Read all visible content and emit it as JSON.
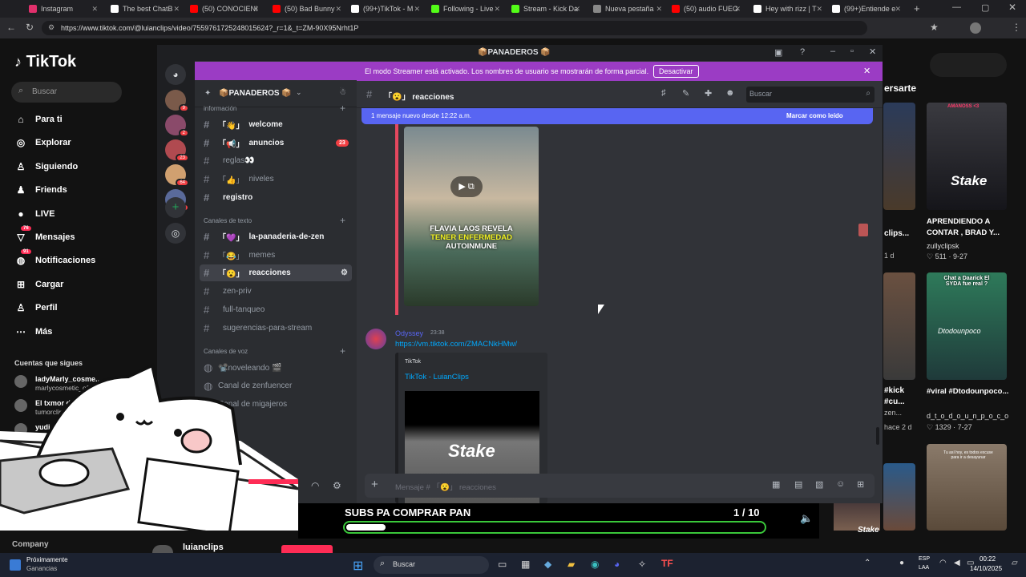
{
  "browser": {
    "tabs": [
      {
        "label": "Instagram",
        "color": "#e1306c"
      },
      {
        "label": "The best ChatB",
        "color": "#ffffff"
      },
      {
        "label": "(50) CONOCIENI",
        "color": "#ff0000"
      },
      {
        "label": "(50) Bad Bunny",
        "color": "#ff0000"
      },
      {
        "label": "(99+)TikTok - M",
        "color": "#ffffff"
      },
      {
        "label": "Following - Live",
        "color": "#53fc18"
      },
      {
        "label": "Stream - Kick Da",
        "color": "#53fc18"
      },
      {
        "label": "Nueva pestaña",
        "color": "#888888"
      },
      {
        "label": "(50) audio FUEG",
        "color": "#ff0000"
      },
      {
        "label": "Hey with rizz | T",
        "color": "#ffffff"
      },
      {
        "label": "(99+)Entiende e",
        "color": "#ffffff"
      }
    ],
    "url": "https://www.tiktok.com/@luianclips/video/7559761725248015624?_r=1&_t=ZM-90X95Nrht1P"
  },
  "tiktok": {
    "logo": "TikTok",
    "search_placeholder": "Buscar",
    "nav": [
      {
        "label": "Para ti",
        "icon": "home-icon"
      },
      {
        "label": "Explorar",
        "icon": "compass-icon"
      },
      {
        "label": "Siguiendo",
        "icon": "following-icon"
      },
      {
        "label": "Friends",
        "icon": "friends-icon"
      },
      {
        "label": "LIVE",
        "icon": "live-icon"
      },
      {
        "label": "Mensajes",
        "icon": "message-icon",
        "badge": "76"
      },
      {
        "label": "Notificaciones",
        "icon": "inbox-icon",
        "badge": "91"
      },
      {
        "label": "Cargar",
        "icon": "upload-icon"
      },
      {
        "label": "Perfil",
        "icon": "profile-icon"
      },
      {
        "label": "Más",
        "icon": "more-icon"
      }
    ],
    "following_title": "Cuentas que sigues",
    "following": [
      {
        "name": "ladyMarly_cosme...",
        "handle": "marlycosmetic_ofici"
      },
      {
        "name": "El txmor de M...",
        "handle": "tumorclips"
      },
      {
        "name": "yudi...",
        "handle": ""
      }
    ],
    "company": "Company",
    "bottom_handle": "luianclips",
    "right_heading": "ersarte",
    "right_cards": [
      {
        "title": "APRENDIENDO A CONTAR , BRAD Y...",
        "author": "zullyclipsk",
        "likes": "511",
        "date": "9-27",
        "overlay": "AMANOSS <3",
        "logo": "Stake"
      },
      {
        "title": "#viral #Dtodounpoco...",
        "author": "d_t_o_d_o_u_n_p_o_c_o",
        "likes": "1329",
        "date": "7-27",
        "overlay": "Chat a Daarick El SYDA fue real ?",
        "watermark": "Dtodounpoco"
      },
      {
        "title": "",
        "author": "",
        "likes": "",
        "date": "",
        "overlay": "Tu así hoy, es todos excuse para ir a desayunar",
        "logo": ""
      }
    ],
    "left_partial": [
      {
        "text": "clips..."
      },
      {
        "text": "1 d"
      },
      {
        "text": "#kick"
      },
      {
        "text": "#cu..."
      },
      {
        "text": "zen..."
      },
      {
        "text": "hace 2 d"
      }
    ]
  },
  "discord": {
    "window_title": "📦PANADEROS 📦",
    "banner": "El modo Streamer está activado. Los nombres de usuario se mostrarán de forma parcial.",
    "banner_button": "Desactivar",
    "server_name": "📦PANADEROS 📦",
    "server_badges": [
      "9",
      "2",
      "23",
      "64",
      "8"
    ],
    "categories": {
      "info": "información",
      "text": "Canales de texto",
      "voice": "Canales de voz"
    },
    "channels_info": [
      {
        "name": "welcome",
        "emoji": "「👋」",
        "bright": true
      },
      {
        "name": "anuncios",
        "emoji": "「📢」",
        "bright": true,
        "badge": "23"
      },
      {
        "name": "reglas👀",
        "emoji": "",
        "bright": false
      },
      {
        "name": "niveles",
        "emoji": "「👍」",
        "bright": false
      },
      {
        "name": "registro",
        "emoji": "",
        "bright": true
      }
    ],
    "channels_text": [
      {
        "name": "la-panaderia-de-zen",
        "emoji": "「💜」",
        "bright": true
      },
      {
        "name": "memes",
        "emoji": "「😂」",
        "bright": false
      },
      {
        "name": "reacciones",
        "emoji": "「😮」",
        "bright": true,
        "active": true
      },
      {
        "name": "zen-priv",
        "emoji": "",
        "bright": false
      },
      {
        "name": "full-tanqueo",
        "emoji": "",
        "bright": false
      },
      {
        "name": "sugerencias-para-stream",
        "emoji": "",
        "bright": false
      }
    ],
    "channels_voice": [
      {
        "name": "📽️noveleando 🎬"
      },
      {
        "name": "Canal de zenfuencer"
      },
      {
        "name": "Canal de migajeros"
      }
    ],
    "channel_header": "「😮」 reacciones",
    "search_placeholder": "Buscar",
    "new_messages": "1 mensaje nuevo desde 12:22 a.m.",
    "mark_read": "Marcar como leído",
    "video_caption": [
      "FLAVIA LAOS REVELA",
      "TENER ENFERMEDAD",
      "AUTOINMUNE"
    ],
    "message": {
      "author": "Odyssey",
      "time": "23:38",
      "link": "https://vm.tiktok.com/ZMACNkHMw/",
      "embed_site": "TikTok",
      "embed_title": "TikTok - LuianClips",
      "embed_logo": "Stake"
    },
    "composer_placeholder": "Mensaje # 「😮」 reacciones"
  },
  "overlay": {
    "subs_text": "SUBS PA COMPRAR PAN",
    "subs_count": "1 / 10",
    "subs_progress": 0.1,
    "stream_logo": "Stake"
  },
  "taskbar": {
    "widget_title": "Próximamente",
    "widget_sub": "Ganancias",
    "search": "Buscar",
    "lang": "ESP",
    "lang2": "LAA",
    "time": "00:22",
    "date": "14/10/2025"
  }
}
